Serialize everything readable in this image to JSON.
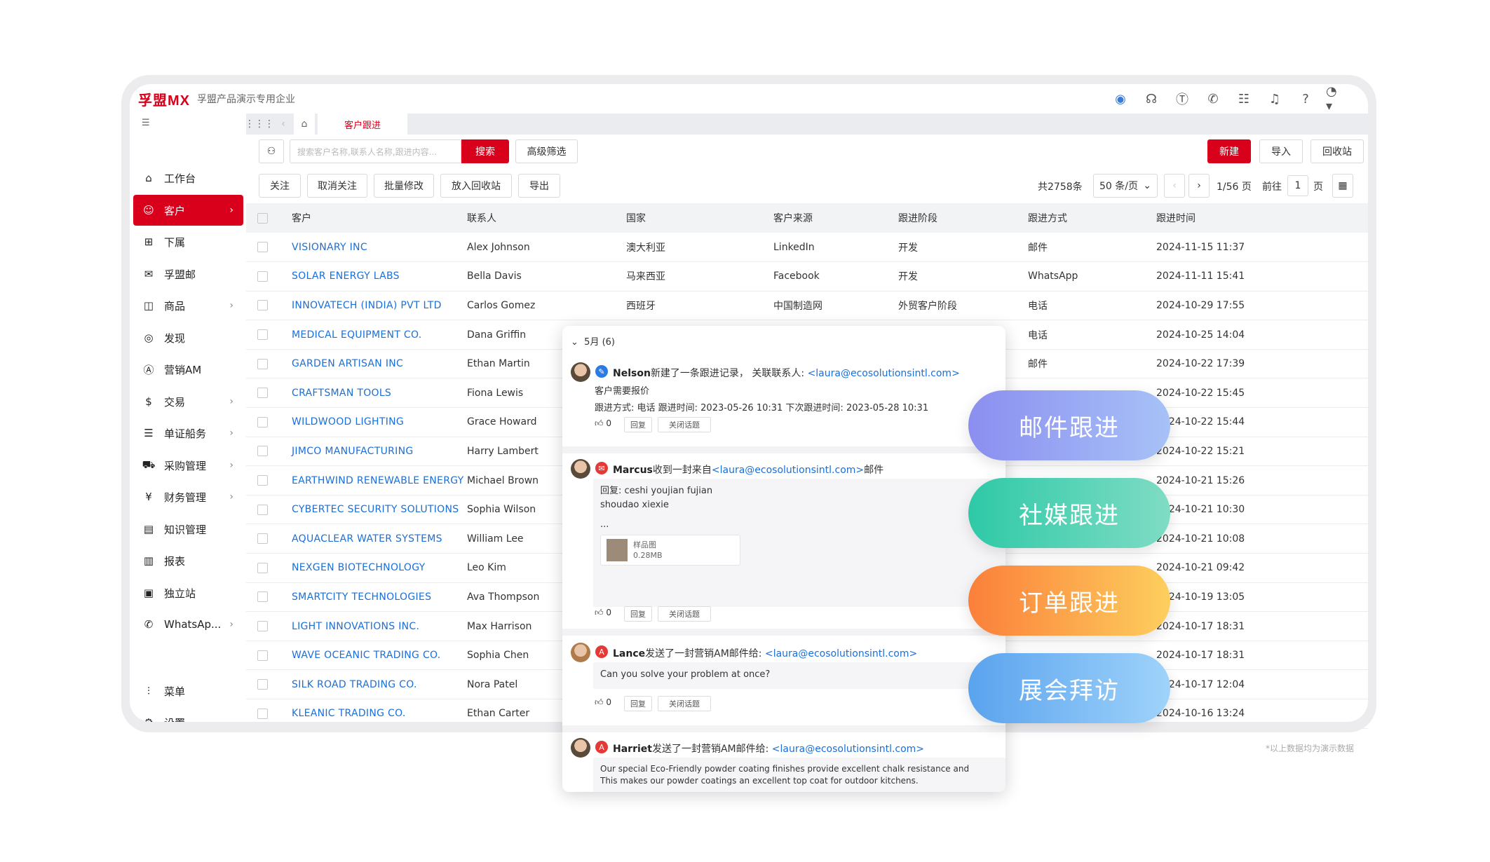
{
  "app": {
    "logo": "孚盟MX",
    "company": "孚盟产品演示专用企业"
  },
  "sidebar": {
    "items": [
      {
        "label": "工作台",
        "icon": "home-icon",
        "glyph": "⌂",
        "arrow": false
      },
      {
        "label": "客户",
        "icon": "customer-icon",
        "glyph": "☺",
        "arrow": true,
        "active": true
      },
      {
        "label": "下属",
        "icon": "subordinate-icon",
        "glyph": "⊞",
        "arrow": false
      },
      {
        "label": "孚盟邮",
        "icon": "mail-icon",
        "glyph": "✉",
        "arrow": false
      },
      {
        "label": "商品",
        "icon": "product-icon",
        "glyph": "◫",
        "arrow": true
      },
      {
        "label": "发现",
        "icon": "discover-icon",
        "glyph": "◎",
        "arrow": false
      },
      {
        "label": "营销AM",
        "icon": "marketing-icon",
        "glyph": "Ⓐ",
        "arrow": false
      },
      {
        "label": "交易",
        "icon": "trade-icon",
        "glyph": "$",
        "arrow": true
      },
      {
        "label": "单证船务",
        "icon": "document-icon",
        "glyph": "☰",
        "arrow": true
      },
      {
        "label": "采购管理",
        "icon": "truck-icon",
        "glyph": "⛟",
        "arrow": true
      },
      {
        "label": "财务管理",
        "icon": "finance-icon",
        "glyph": "¥",
        "arrow": true
      },
      {
        "label": "知识管理",
        "icon": "book-icon",
        "glyph": "▤",
        "arrow": false
      },
      {
        "label": "报表",
        "icon": "chart-icon",
        "glyph": "▥",
        "arrow": false
      },
      {
        "label": "独立站",
        "icon": "site-icon",
        "glyph": "▣",
        "arrow": false
      },
      {
        "label": "WhatsAp...",
        "icon": "whatsapp-icon",
        "glyph": "✆",
        "arrow": true
      }
    ],
    "bottom": [
      {
        "label": "菜单",
        "icon": "sliders-icon",
        "glyph": "⫶"
      },
      {
        "label": "设置",
        "icon": "settings-icon",
        "glyph": "⚙"
      }
    ]
  },
  "tabs": {
    "active": "客户跟进"
  },
  "toolbar": {
    "search_placeholder": "搜索客户名称,联系人名称,跟进内容...",
    "search": "搜索",
    "advanced": "高级筛选",
    "new": "新建",
    "import": "导入",
    "recycle": "回收站",
    "follow": "关注",
    "unfollow": "取消关注",
    "batch": "批量修改",
    "to_recycle": "放入回收站",
    "export": "导出"
  },
  "pagination": {
    "total": "共2758条",
    "per_page": "50 条/页",
    "pages": "1/56 页",
    "goto": "前往",
    "page": "1",
    "page_unit": "页"
  },
  "table": {
    "headers": [
      "客户",
      "联系人",
      "国家",
      "客户来源",
      "跟进阶段",
      "跟进方式",
      "跟进时间"
    ],
    "rows": [
      [
        "VISIONARY INC",
        "Alex Johnson",
        "澳大利亚",
        "LinkedIn",
        "开发",
        "邮件",
        "2024-11-15 11:37"
      ],
      [
        "SOLAR ENERGY LABS",
        "Bella Davis",
        "马来西亚",
        "Facebook",
        "开发",
        "WhatsApp",
        "2024-11-11 15:41"
      ],
      [
        "INNOVATECH (INDIA) PVT LTD",
        "Carlos Gomez",
        "西班牙",
        "中国制造网",
        "外贸客户阶段",
        "电话",
        "2024-10-29 17:55"
      ],
      [
        "MEDICAL EQUIPMENT CO.",
        "Dana Griffin",
        "",
        "",
        "",
        "电话",
        "2024-10-25 14:04"
      ],
      [
        "GARDEN ARTISAN INC",
        "Ethan Martin",
        "",
        "",
        "",
        "邮件",
        "2024-10-22 17:39"
      ],
      [
        "CRAFTSMAN TOOLS",
        "Fiona Lewis",
        "",
        "",
        "",
        "",
        "2024-10-22 15:45"
      ],
      [
        "WILDWOOD LIGHTING",
        "Grace Howard",
        "",
        "",
        "",
        "",
        "2024-10-22 15:44"
      ],
      [
        "JIMCO MANUFACTURING",
        "Harry Lambert",
        "",
        "",
        "",
        "",
        "2024-10-22 15:21"
      ],
      [
        "EARTHWIND RENEWABLE ENERGY",
        "Michael Brown",
        "",
        "",
        "",
        "",
        "2024-10-21 15:26"
      ],
      [
        "CYBERTEC SECURITY SOLUTIONS",
        "Sophia Wilson",
        "",
        "",
        "",
        "",
        "2024-10-21 10:30"
      ],
      [
        "AQUACLEAR WATER SYSTEMS",
        "William Lee",
        "",
        "",
        "",
        "",
        "2024-10-21 10:08"
      ],
      [
        "NEXGEN BIOTECHNOLOGY",
        "Leo Kim",
        "",
        "",
        "",
        "",
        "2024-10-21 09:42"
      ],
      [
        "SMARTCITY TECHNOLOGIES",
        "Ava Thompson",
        "",
        "",
        "",
        "",
        "2024-10-19 13:05"
      ],
      [
        "LIGHT INNOVATIONS INC.",
        "Max Harrison",
        "",
        "",
        "",
        "",
        "2024-10-17 18:31"
      ],
      [
        "WAVE OCEANIC TRADING CO.",
        "Sophia Chen",
        "",
        "",
        "",
        "",
        "2024-10-17 18:31"
      ],
      [
        "SILK ROAD TRADING CO.",
        "Nora Patel",
        "",
        "",
        "",
        "",
        "2024-10-17 12:04"
      ],
      [
        "KLEANIC TRADING CO.",
        "Ethan Carter",
        "",
        "",
        "",
        "",
        "2024-10-16 13:24"
      ]
    ]
  },
  "popup": {
    "month": "5月 (6)",
    "e1": {
      "name": "Nelson",
      "action": "新建了一条跟进记录， 关联联系人:",
      "email": "<laura@ecosolutionsintl.com>",
      "content": "客户需要报价",
      "meta": "跟进方式: 电话    跟进时间: 2023-05-26 10:31    下次跟进时间: 2023-05-28 10:31",
      "likes": "0"
    },
    "e2": {
      "name": "Marcus",
      "action": "收到一封来自",
      "email": "<laura@ecosolutionsintl.com>",
      "suffix": "邮件",
      "l1": "回复: ceshi youjian fujian",
      "l2": "shoudao xiexie",
      "l3": "...",
      "file": "样品图",
      "size": "0.28MB",
      "likes": "0"
    },
    "e3": {
      "name": "Lance",
      "action": "发送了一封营销AM邮件给:",
      "email": "<laura@ecosolutionsintl.com>",
      "content": "Can you solve your problem at once?",
      "likes": "0"
    },
    "e4": {
      "name": "Harriet",
      "action": "发送了一封营销AM邮件给:",
      "email": "<laura@ecosolutionsintl.com>",
      "l1": "Our special Eco-Friendly powder coating finishes provide excellent chalk resistance and",
      "l2": "This makes our powder coatings an excellent top coat for outdoor kitchens."
    },
    "reply": "回复",
    "close": "关闭话题"
  },
  "pills": [
    "邮件跟进",
    "社媒跟进",
    "订单跟进",
    "展会拜访"
  ],
  "note": "*以上数据均为演示数据"
}
